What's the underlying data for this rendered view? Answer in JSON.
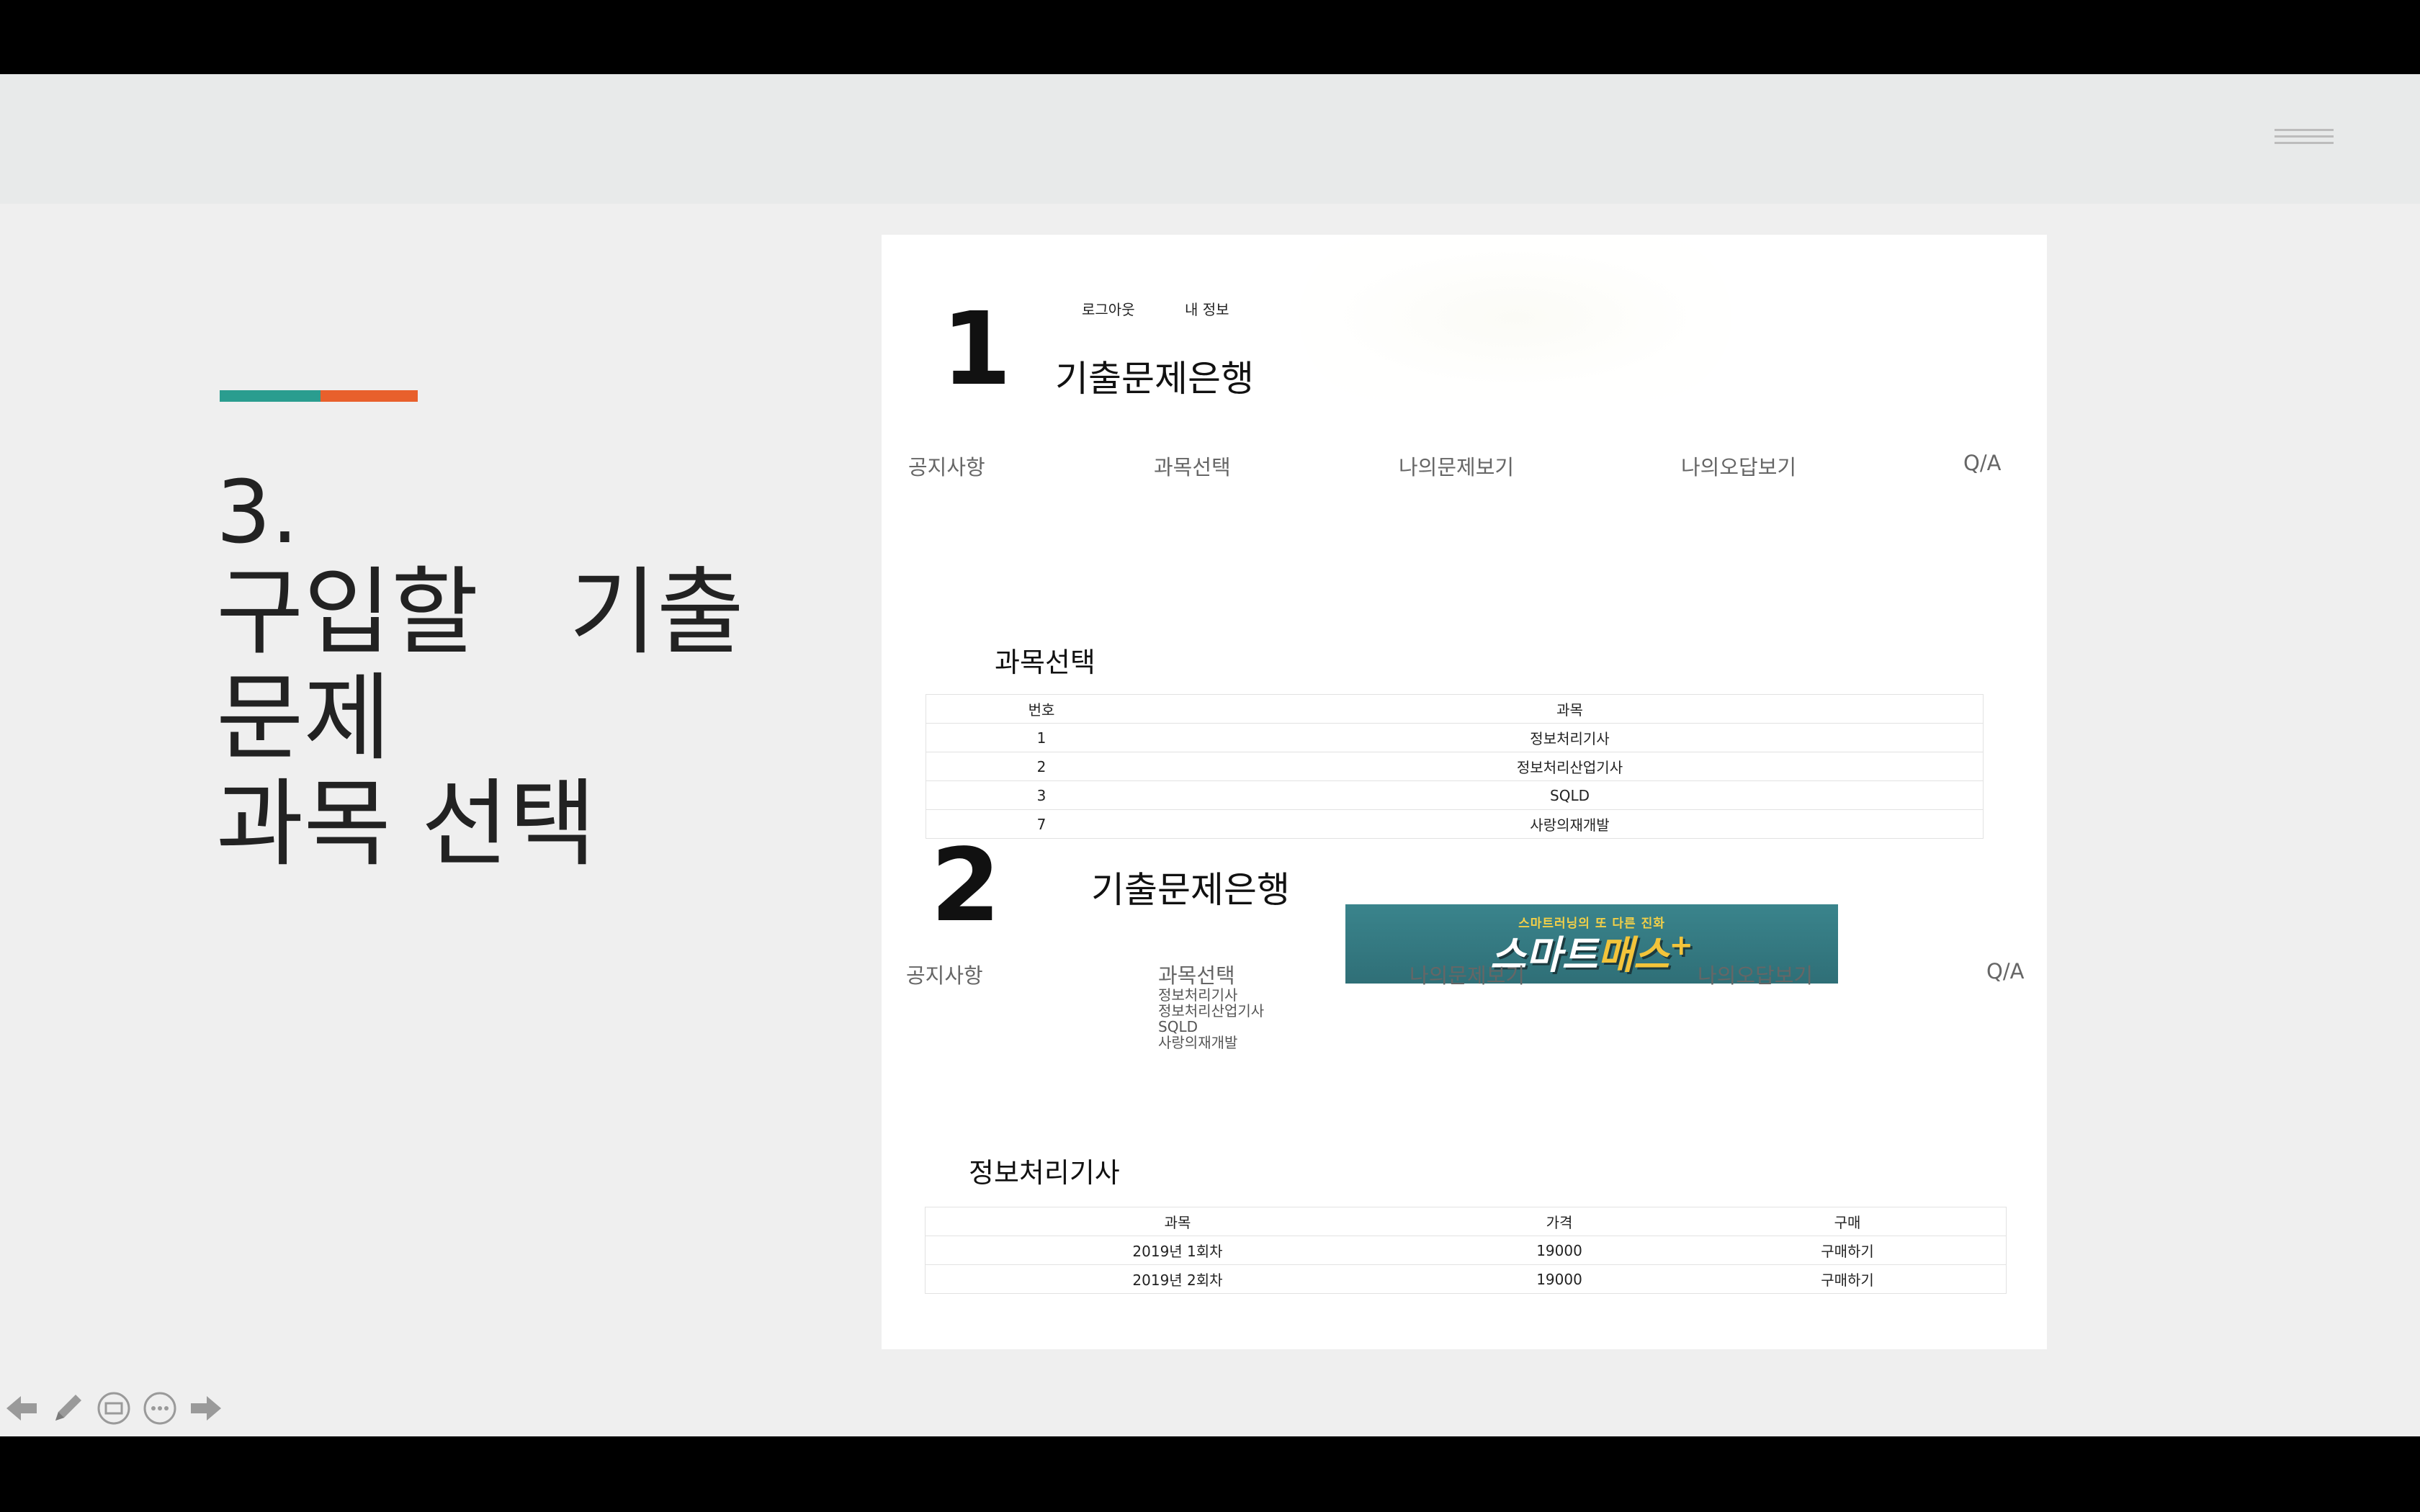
{
  "slide": {
    "number": "3.",
    "title_lines": [
      "구입할   기출",
      "문제",
      "과목 선택"
    ]
  },
  "screens": [
    {
      "step": "1",
      "top_links": [
        "로그아웃",
        "내 정보"
      ],
      "site_title": "기출문제은행",
      "nav": [
        "공지사항",
        "과목선택",
        "나의문제보기",
        "나의오답보기",
        "Q/A"
      ],
      "section_title": "과목선택",
      "table": {
        "headers": [
          "번호",
          "과목"
        ],
        "rows": [
          [
            "1",
            "정보처리기사"
          ],
          [
            "2",
            "정보처리산업기사"
          ],
          [
            "3",
            "SQLD"
          ],
          [
            "7",
            "사랑의재개발"
          ]
        ]
      }
    },
    {
      "step": "2",
      "site_title": "기출문제은행",
      "banner": {
        "sub": "스마트러닝의 또 다른 진화",
        "main_a": "스마트",
        "main_b": "매스",
        "plus": "+"
      },
      "nav": [
        "공지사항",
        "과목선택",
        "나의문제보기",
        "나의오답보기",
        "Q/A"
      ],
      "dropdown": [
        "정보처리기사",
        "정보처리산업기사",
        "SQLD",
        "사랑의재개발"
      ],
      "section_title": "정보처리기사",
      "table": {
        "headers": [
          "과목",
          "가격",
          "구매"
        ],
        "rows": [
          [
            "2019년 1회차",
            "19000",
            "구매하기"
          ],
          [
            "2019년 2회차",
            "19000",
            "구매하기"
          ]
        ]
      }
    }
  ],
  "toolbar": {
    "icons": [
      "back-arrow-icon",
      "pen-icon",
      "slides-icon",
      "more-icon",
      "forward-arrow-icon"
    ]
  },
  "colors": {
    "accent_teal": "#2a9d8f",
    "accent_orange": "#e8602c",
    "banner": "#33767e"
  }
}
